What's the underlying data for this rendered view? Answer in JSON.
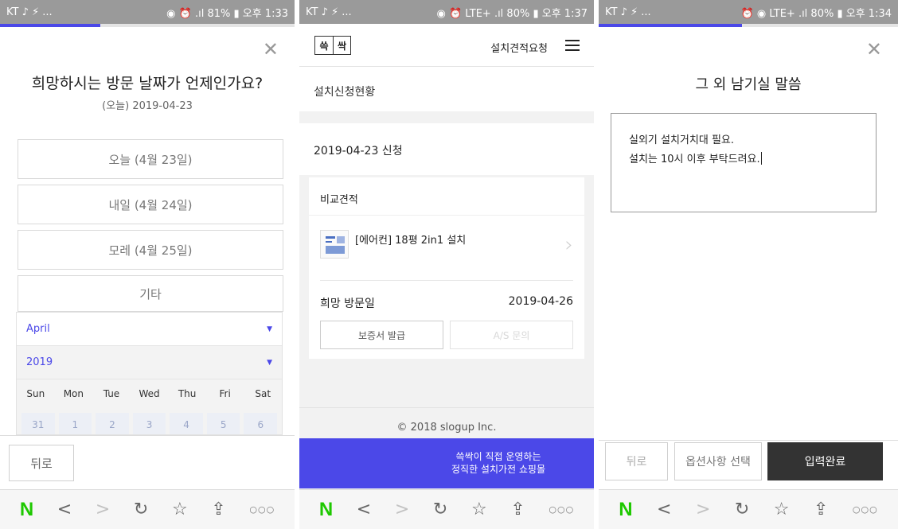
{
  "panel1": {
    "status": {
      "left": "KT ♪ ⚡ ...",
      "right": "◉ ⏰ .ıl 81% ▮ 오후 1:33"
    },
    "progress": 0.34,
    "title": "희망하시는 방문 날짜가 언제인가요?",
    "subtitle": "(오늘) 2019-04-23",
    "options": [
      "오늘 (4월 23일)",
      "내일 (4월 24일)",
      "모레 (4월 25일)",
      "기타"
    ],
    "calendar": {
      "month": "April",
      "year": "2019",
      "weekdays": [
        "Sun",
        "Mon",
        "Tue",
        "Wed",
        "Thu",
        "Fri",
        "Sat"
      ],
      "dates": [
        "31",
        "1",
        "2",
        "3",
        "4",
        "5",
        "6"
      ]
    },
    "back_label": "뒤로"
  },
  "panel2": {
    "status": {
      "left": "KT ♪ ⚡ ...",
      "right": "◉ ⏰ LTE+ .ıl 80% ▮ 오후 1:37"
    },
    "logo": [
      "쓱",
      "싹"
    ],
    "request_label": "설치견적요청",
    "section_status": "설치신청현황",
    "date_applied": "2019-04-23 신청",
    "card_title": "비교견적",
    "product_name": "[에어컨] 18평 2in1 설치",
    "visit_label": "희망 방문일",
    "visit_date": "2019-04-26",
    "btn_warranty": "보증서 발급",
    "btn_as": "A/S 문의",
    "copyright": "© 2018 slogup Inc.",
    "banner_line1": "쓱싹이 직접 운영하는",
    "banner_line2": "정직한 설치가전 쇼핑몰"
  },
  "panel3": {
    "status": {
      "left": "KT ♪ ⚡ ...",
      "right": "⏰ ◉ LTE+ .ıl 80% ▮ 오후 1:34"
    },
    "progress": 0.48,
    "title": "그 외 남기실 말씀",
    "memo_line1": "실외기 설치거치대 필요.",
    "memo_line2": "설치는 10시 이후 부탁드려요.",
    "back_label": "뒤로",
    "options_label": "옵션사항 선택",
    "done_label": "입력완료"
  },
  "browser": {
    "n_logo": "N",
    "icons": [
      "back-icon",
      "forward-icon",
      "refresh-icon",
      "star-icon",
      "share-icon",
      "more-icon"
    ]
  }
}
